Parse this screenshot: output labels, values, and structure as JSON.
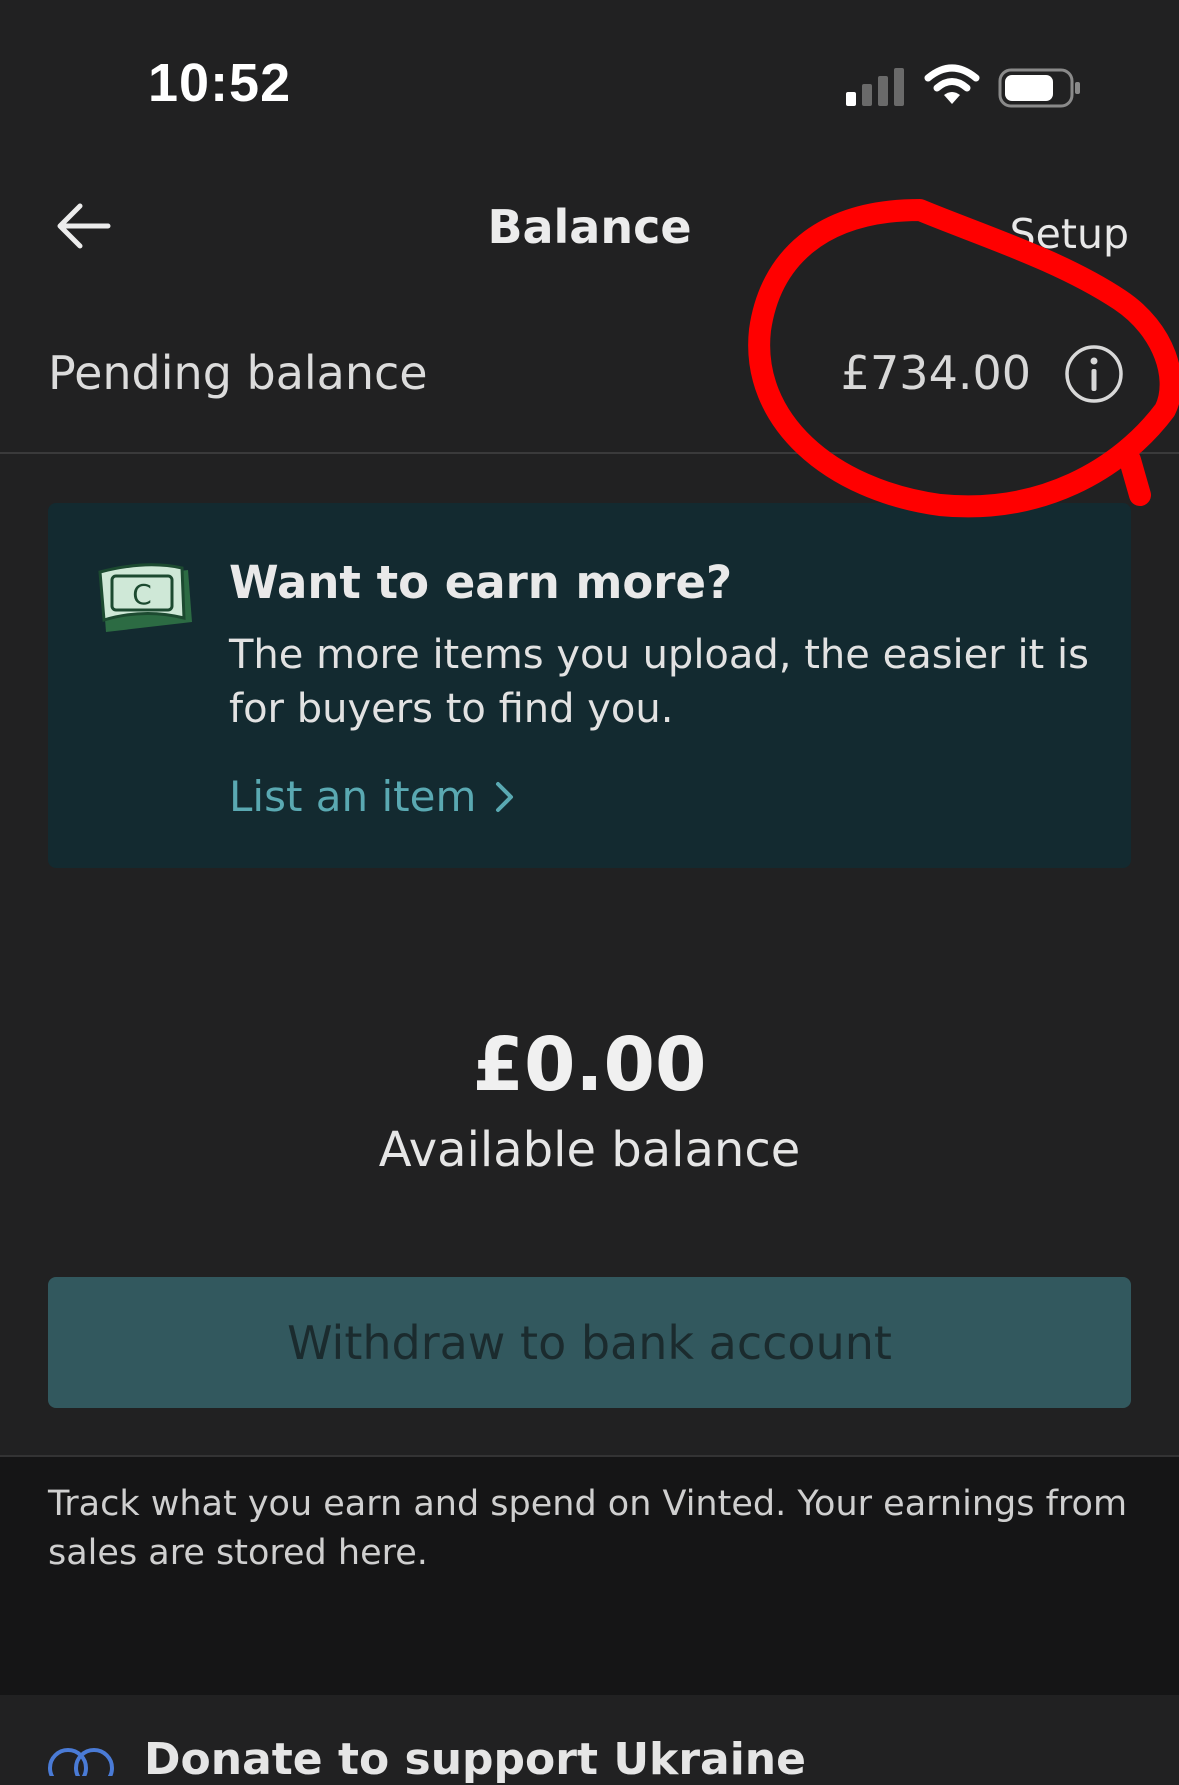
{
  "status_bar": {
    "time": "10:52"
  },
  "nav": {
    "title": "Balance",
    "setup_label": "Setup"
  },
  "pending": {
    "label": "Pending balance",
    "amount": "£734.00"
  },
  "promo": {
    "title": "Want to earn more?",
    "body": "The more items you upload, the easier it is for buyers to find you.",
    "link_label": "List an item",
    "icon_letter": "C"
  },
  "available": {
    "amount": "£0.00",
    "label": "Available balance"
  },
  "withdraw": {
    "label": "Withdraw to bank account"
  },
  "footer": {
    "text": "Track what you earn and spend on Vinted. Your earnings from sales are stored here.",
    "partial_text": "Donate to support Ukraine"
  },
  "colors": {
    "background": "#212122",
    "promo_card": "#132a30",
    "accent_link": "#5aa9b2",
    "withdraw_button": "#32585e",
    "annotation": "#ff0000"
  }
}
